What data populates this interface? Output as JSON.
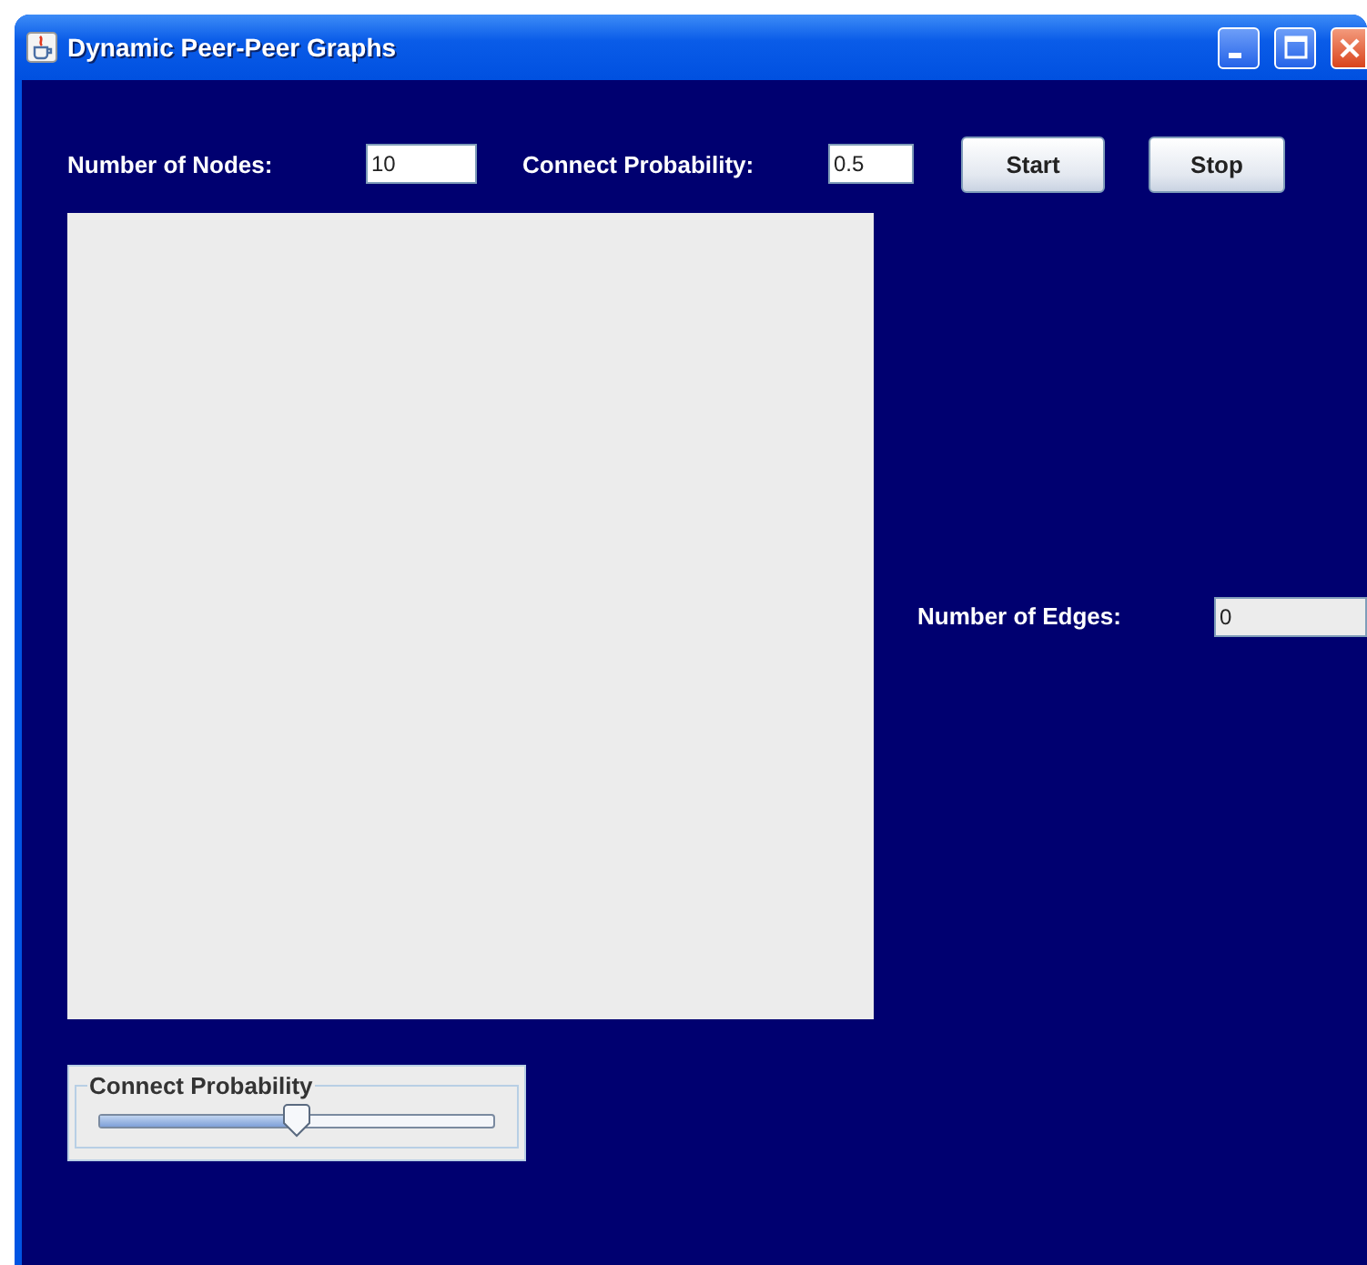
{
  "window": {
    "title": "Dynamic Peer-Peer Graphs"
  },
  "controls": {
    "nodes_label": "Number of Nodes:",
    "nodes_value": "10",
    "probability_label": "Connect Probability:",
    "probability_value": "0.5",
    "buttons": [
      "Start",
      "Stop"
    ]
  },
  "edges": {
    "label": "Number of Edges:",
    "value": "0"
  },
  "slider": {
    "title": "Connect Probability",
    "level": 0.5
  }
}
